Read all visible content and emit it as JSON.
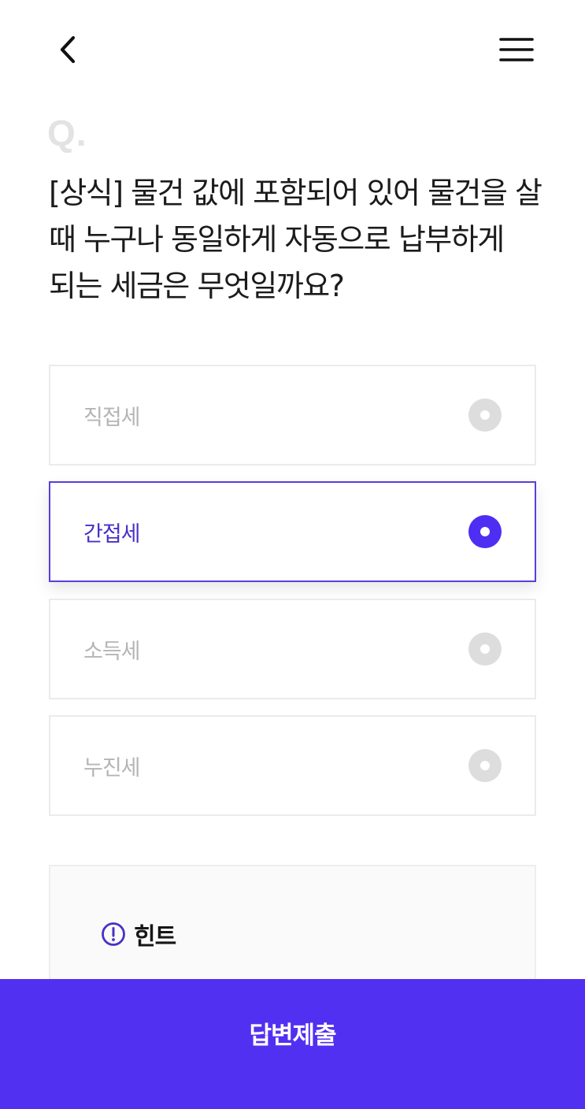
{
  "header": {
    "back_icon": "chevron-left-icon",
    "menu_icon": "hamburger-menu-icon"
  },
  "question": {
    "marker": "Q.",
    "text": "[상식] 물건 값에 포함되어 있어 물건을 살 때 누구나 동일하게 자동으로 납부하게 되는 세금은 무엇일까요?"
  },
  "options": [
    {
      "label": "직접세",
      "selected": false
    },
    {
      "label": "간접세",
      "selected": true
    },
    {
      "label": "소득세",
      "selected": false
    },
    {
      "label": "누진세",
      "selected": false
    }
  ],
  "hint": {
    "icon": "exclamation-circle-icon",
    "label": "힌트"
  },
  "submit": {
    "label": "답변제출"
  },
  "colors": {
    "accent": "#5230F2",
    "selected_text": "#4A2FC8",
    "selected_border": "#5B3FD9",
    "unselected_text": "#B5B5B5",
    "radio_off": "#DDDDDD"
  }
}
